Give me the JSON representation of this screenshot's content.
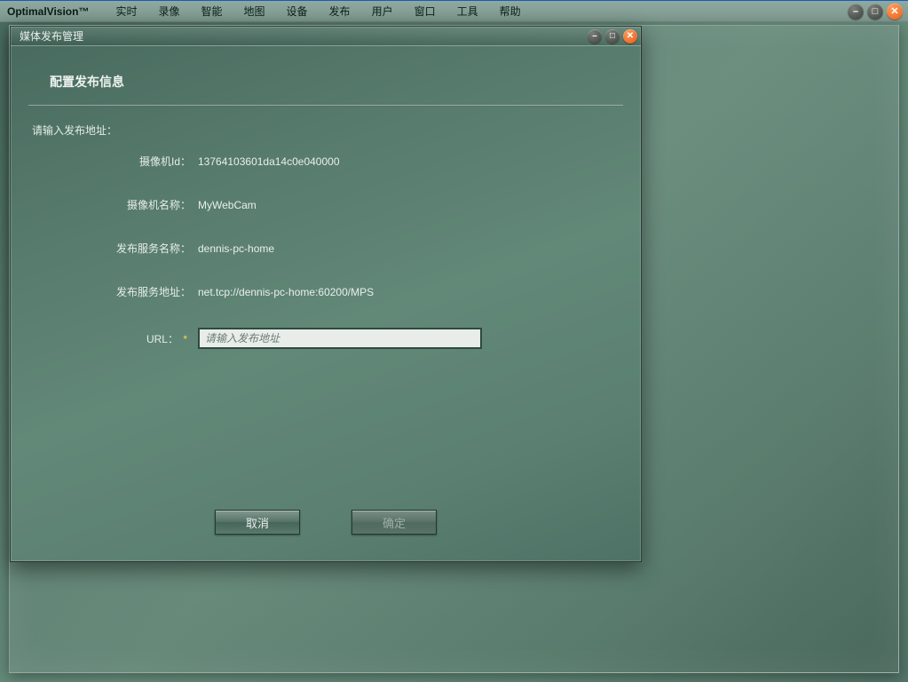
{
  "app": {
    "title": "OptimalVision™",
    "menu": [
      "实时",
      "录像",
      "智能",
      "地图",
      "设备",
      "发布",
      "用户",
      "窗口",
      "工具",
      "帮助"
    ]
  },
  "dialog": {
    "title": "媒体发布管理",
    "section_title": "配置发布信息",
    "prompt": "请输入发布地址：",
    "fields": {
      "camera_id_label": "摄像机Id：",
      "camera_id_value": "13764103601da14c0e040000",
      "camera_name_label": "摄像机名称：",
      "camera_name_value": "MyWebCam",
      "publish_service_name_label": "发布服务名称：",
      "publish_service_name_value": "dennis-pc-home",
      "publish_service_addr_label": "发布服务地址：",
      "publish_service_addr_value": "net.tcp://dennis-pc-home:60200/MPS",
      "url_label": "URL：",
      "url_required": "*",
      "url_placeholder": "请输入发布地址"
    },
    "buttons": {
      "cancel": "取消",
      "ok": "确定"
    }
  },
  "glyphs": {
    "minimize": "–",
    "maximize": "□",
    "close": "✕"
  }
}
